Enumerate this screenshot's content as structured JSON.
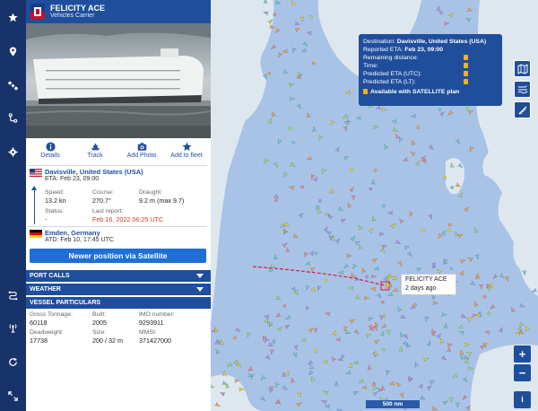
{
  "vessel": {
    "name": "FELICITY ACE",
    "type": "Vehicles Carrier"
  },
  "actions": [
    {
      "label": "Details",
      "icon": "info-icon"
    },
    {
      "label": "Track",
      "icon": "ship-track-icon"
    },
    {
      "label": "Add Photo",
      "icon": "camera-icon"
    },
    {
      "label": "Add to fleet",
      "icon": "star-icon"
    }
  ],
  "destination": {
    "place": "Davisville, United States (USA)",
    "eta": "ETA: Feb 23, 09:00"
  },
  "stats": {
    "speed_label": "Speed:",
    "speed": "13.2 kn",
    "course_label": "Course:",
    "course": "270.7°",
    "draught_label": "Draught:",
    "draught": "9.2 m (max 9.7)",
    "status_label": "Status:",
    "status": "-",
    "last_report_label": "Last report:",
    "last_report": "Feb 16, 2022 06:25 UTC"
  },
  "departure": {
    "place": "Emden, Germany",
    "atd": "ATD: Feb 10, 17:45 UTC"
  },
  "satellite_button": "Newer position via Satellite",
  "sections": {
    "port_calls": "PORT CALLS",
    "weather": "WEATHER",
    "particulars": "VESSEL PARTICULARS"
  },
  "particulars": {
    "gross_tonnage_label": "Gross Tonnage:",
    "gross_tonnage": "60118",
    "built_label": "Built:",
    "built": "2005",
    "imo_label": "IMO number:",
    "imo": "9293911",
    "deadweight_label": "Deadweight:",
    "deadweight": "17738",
    "size_label": "Size:",
    "size": "200 / 32 m",
    "mmsi_label": "MMSI:",
    "mmsi": "371427000"
  },
  "eta_tooltip": {
    "destination_label": "Destination:",
    "destination": "Davisville, United States (USA)",
    "reported_eta_label": "Reported ETA:",
    "reported_eta": "Feb 23, 09:00",
    "remaining_distance": "Remaining distance:",
    "time": "Time:",
    "predicted_utc": "Predicted ETA (UTC):",
    "predicted_lt": "Predicted ETA (LT):",
    "satellite_note": "Available with SATELLITE plan"
  },
  "map_label": {
    "name": "FELICITY ACE",
    "age": "2 days ago"
  },
  "map": {
    "scale": "500 nm",
    "zoom_in": "+",
    "zoom_out": "−",
    "info": "i"
  },
  "rail_icons": [
    "star-icon",
    "location-pin-icon",
    "satellite-icon",
    "route-icon",
    "settings-icon",
    "routes-icon",
    "antenna-icon",
    "refresh-icon",
    "fullscreen-icon"
  ],
  "colors": {
    "brand_dark": "#18326a",
    "brand": "#1f4e9c",
    "button": "#1f6fd4",
    "alert_text": "#d83a2a",
    "ocean": "#a9c3e6",
    "land": "#dfe7ee",
    "track": "#d81b4a"
  }
}
